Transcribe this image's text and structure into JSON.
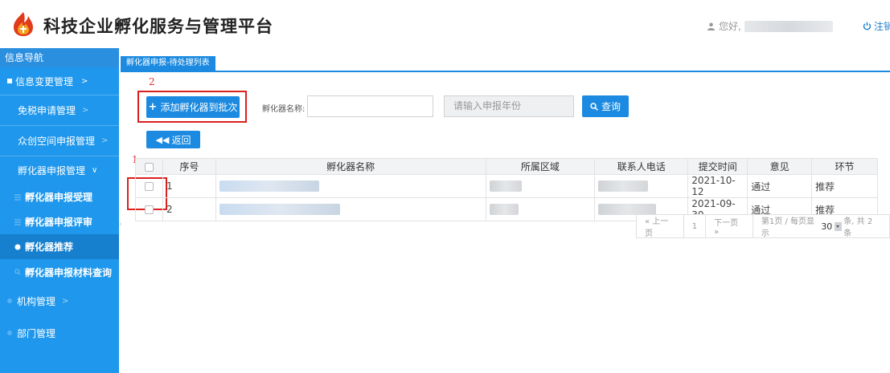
{
  "header": {
    "app_title": "科技企业孵化服务与管理平台",
    "greeting": "您好,",
    "logout_label": "注销"
  },
  "sidebar": {
    "heading": "信息导航",
    "items": [
      {
        "label": "信息变更管理"
      },
      {
        "label": "免税申请管理"
      },
      {
        "label": "众创空间申报管理"
      },
      {
        "label": "孵化器申报管理"
      },
      {
        "label": "机构管理"
      },
      {
        "label": "部门管理"
      }
    ],
    "subitems": [
      {
        "label": "孵化器申报受理"
      },
      {
        "label": "孵化器申报评审"
      },
      {
        "label": "孵化器推荐"
      },
      {
        "label": "孵化器申报材料查询"
      }
    ]
  },
  "tab": {
    "label": "孵化器申报-待处理列表"
  },
  "annotations": {
    "marker1": "1",
    "marker2": "2"
  },
  "toolbar": {
    "add_label": "添加孵化器到批次",
    "search_label": "孵化器名称:",
    "name_value": "",
    "year_placeholder": "请输入申报年份",
    "query_label": "查询",
    "back_label": "返回"
  },
  "table": {
    "headers": [
      "序号",
      "孵化器名称",
      "所属区域",
      "联系人电话",
      "提交时间",
      "意见",
      "环节"
    ],
    "rows": [
      {
        "index": "1",
        "date": "2021-10-12",
        "opinion": "通过",
        "stage": "推荐"
      },
      {
        "index": "2",
        "date": "2021-09-30",
        "opinion": "通过",
        "stage": "推荐"
      }
    ]
  },
  "pager": {
    "prev": "« 上一页",
    "current": "1",
    "next": "下一页 »",
    "info_prefix": "第1页 / 每页显示",
    "page_size": "30",
    "info_suffix": "条, 共 2 条"
  },
  "colors": {
    "primary": "#1b8ae0",
    "sidebar": "#1e97ec",
    "annotation": "#d9211f",
    "link": "#1b7fd4"
  },
  "icons": [
    "logo-flame-icon",
    "user-icon",
    "power-icon",
    "plus-icon",
    "search-icon",
    "back-icon"
  ]
}
